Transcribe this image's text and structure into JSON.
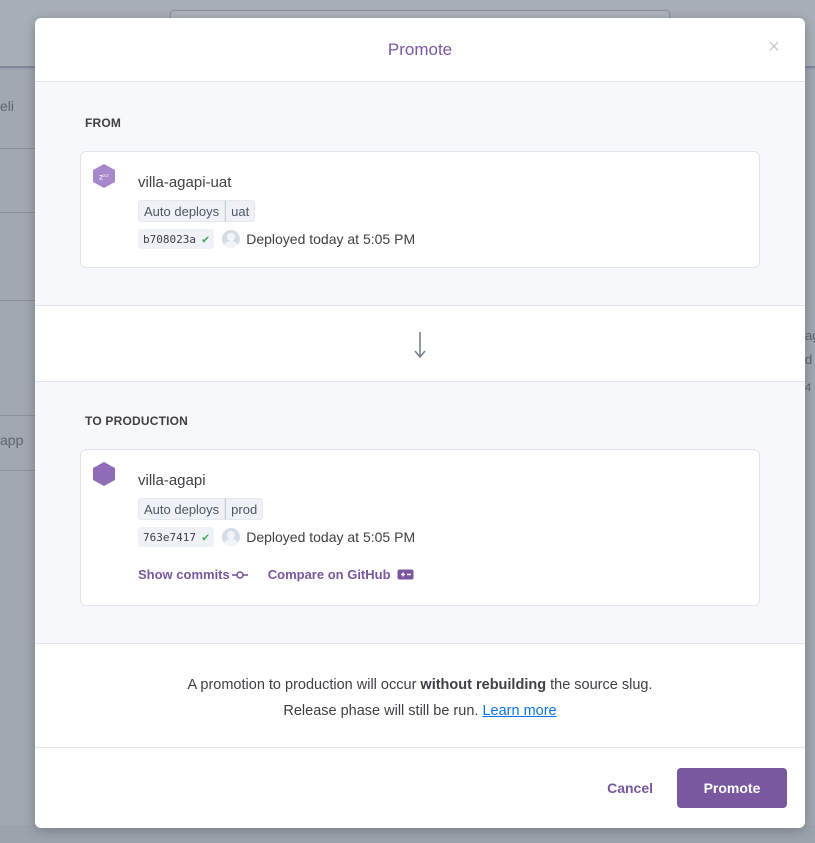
{
  "background": {
    "left_text_1": "eli",
    "left_text_2": "app",
    "right_text_1": "ag",
    "right_text_2": "d",
    "right_text_3": "4"
  },
  "modal": {
    "title": "Promote",
    "close_symbol": "×"
  },
  "from": {
    "label": "FROM",
    "app_name": "villa-agapi-uat",
    "icon": "sleeping-dyno-icon",
    "icon_text": "zᶻᶻ",
    "badge_auto": "Auto deploys",
    "badge_env": "uat",
    "sha": "b708023a",
    "check": "✔",
    "deployed_text": "Deployed today at 5:05 PM"
  },
  "to": {
    "label": "TO PRODUCTION",
    "app_name": "villa-agapi",
    "icon": "hexagon-app-icon",
    "badge_auto": "Auto deploys",
    "badge_env": "prod",
    "sha": "763e7417",
    "check": "✔",
    "deployed_text": "Deployed today at 5:05 PM",
    "show_commits": "Show commits",
    "compare": "Compare on GitHub"
  },
  "notice": {
    "text_before": "A promotion to production will occur ",
    "text_bold": "without rebuilding",
    "text_after": " the source slug.",
    "line2": "Release phase will still be run. ",
    "learn_more": "Learn more"
  },
  "footer": {
    "cancel": "Cancel",
    "promote": "Promote"
  },
  "colors": {
    "accent": "#79589f",
    "link": "#0b74de",
    "check": "#3ea85b"
  }
}
